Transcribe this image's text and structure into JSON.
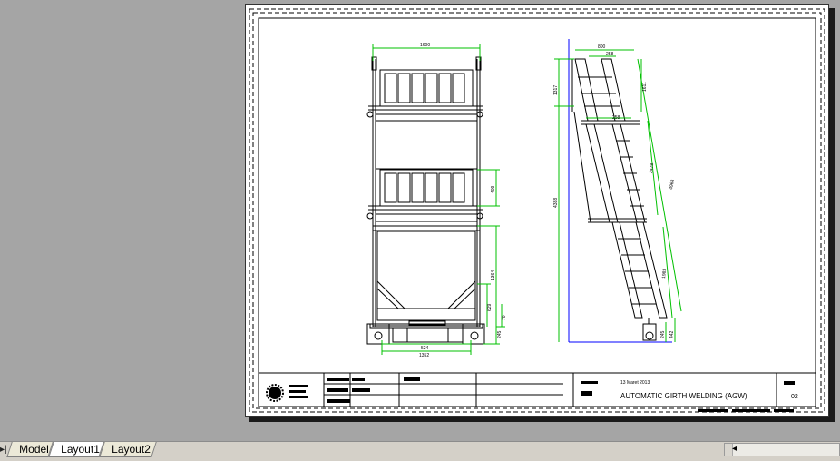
{
  "tabs": [
    {
      "label": "Model",
      "active": false
    },
    {
      "label": "Layout1",
      "active": true
    },
    {
      "label": "Layout2",
      "active": false
    }
  ],
  "title_block": {
    "date": "13 Maret 2013",
    "title": "AUTOMATIC GIRTH WELDING (AGW)",
    "sheet_number": "02"
  },
  "front_view": {
    "dims": {
      "top_width": "1600",
      "bottom_inner": "524",
      "bottom_overall": "1352",
      "right_step": "409",
      "right_lower": "1364",
      "right_base": "629",
      "right_small": "70",
      "right_foot": "245"
    }
  },
  "side_view": {
    "dims": {
      "top_width": "800",
      "top_inner": "258",
      "mid_inner": "258",
      "left_top": "1317",
      "total_height": "4388",
      "diag_upper": "1611",
      "diag_mid": "2478",
      "diag_long": "4968",
      "diag_lower": "1983",
      "foot_a": "245",
      "foot_b": "442"
    }
  },
  "colors": {
    "dimension": "#00c000",
    "axis": "#0000ff",
    "ink": "#000000"
  }
}
